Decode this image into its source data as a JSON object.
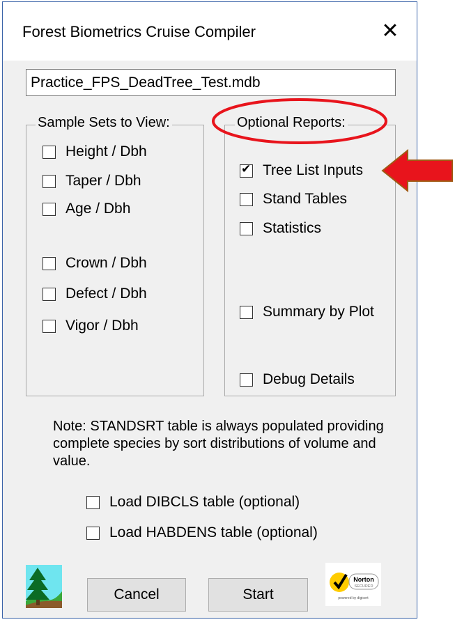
{
  "window": {
    "title": "Forest Biometrics Cruise Compiler",
    "close_glyph": "✕"
  },
  "file_field": {
    "value": "Practice_FPS_DeadTree_Test.mdb"
  },
  "sample_sets": {
    "legend": "Sample Sets to View:",
    "items": [
      {
        "label": "Height / Dbh",
        "checked": false
      },
      {
        "label": "Taper / Dbh",
        "checked": false
      },
      {
        "label": "Age / Dbh",
        "checked": false
      },
      {
        "label": "Crown / Dbh",
        "checked": false
      },
      {
        "label": "Defect / Dbh",
        "checked": false
      },
      {
        "label": "Vigor / Dbh",
        "checked": false
      }
    ]
  },
  "optional_reports": {
    "legend": "Optional Reports:",
    "items": [
      {
        "label": "Tree List Inputs",
        "checked": true
      },
      {
        "label": "Stand Tables",
        "checked": false
      },
      {
        "label": "Statistics",
        "checked": false
      },
      {
        "label": "Summary by Plot",
        "checked": false
      },
      {
        "label": "Debug Details",
        "checked": false
      }
    ]
  },
  "note": "Note:  STANDSRT table is always populated providing complete species by sort distributions of volume and value.",
  "load_options": [
    {
      "label": "Load DIBCLS table (optional)",
      "checked": false
    },
    {
      "label": "Load HABDENS table (optional)",
      "checked": false
    }
  ],
  "buttons": {
    "cancel": "Cancel",
    "start": "Start"
  },
  "norton": {
    "brand": "Norton",
    "secured": "SECURED",
    "powered": "powered by digicert"
  },
  "colors": {
    "annotation_red": "#e8141c",
    "title_border": "#3a63a8"
  }
}
